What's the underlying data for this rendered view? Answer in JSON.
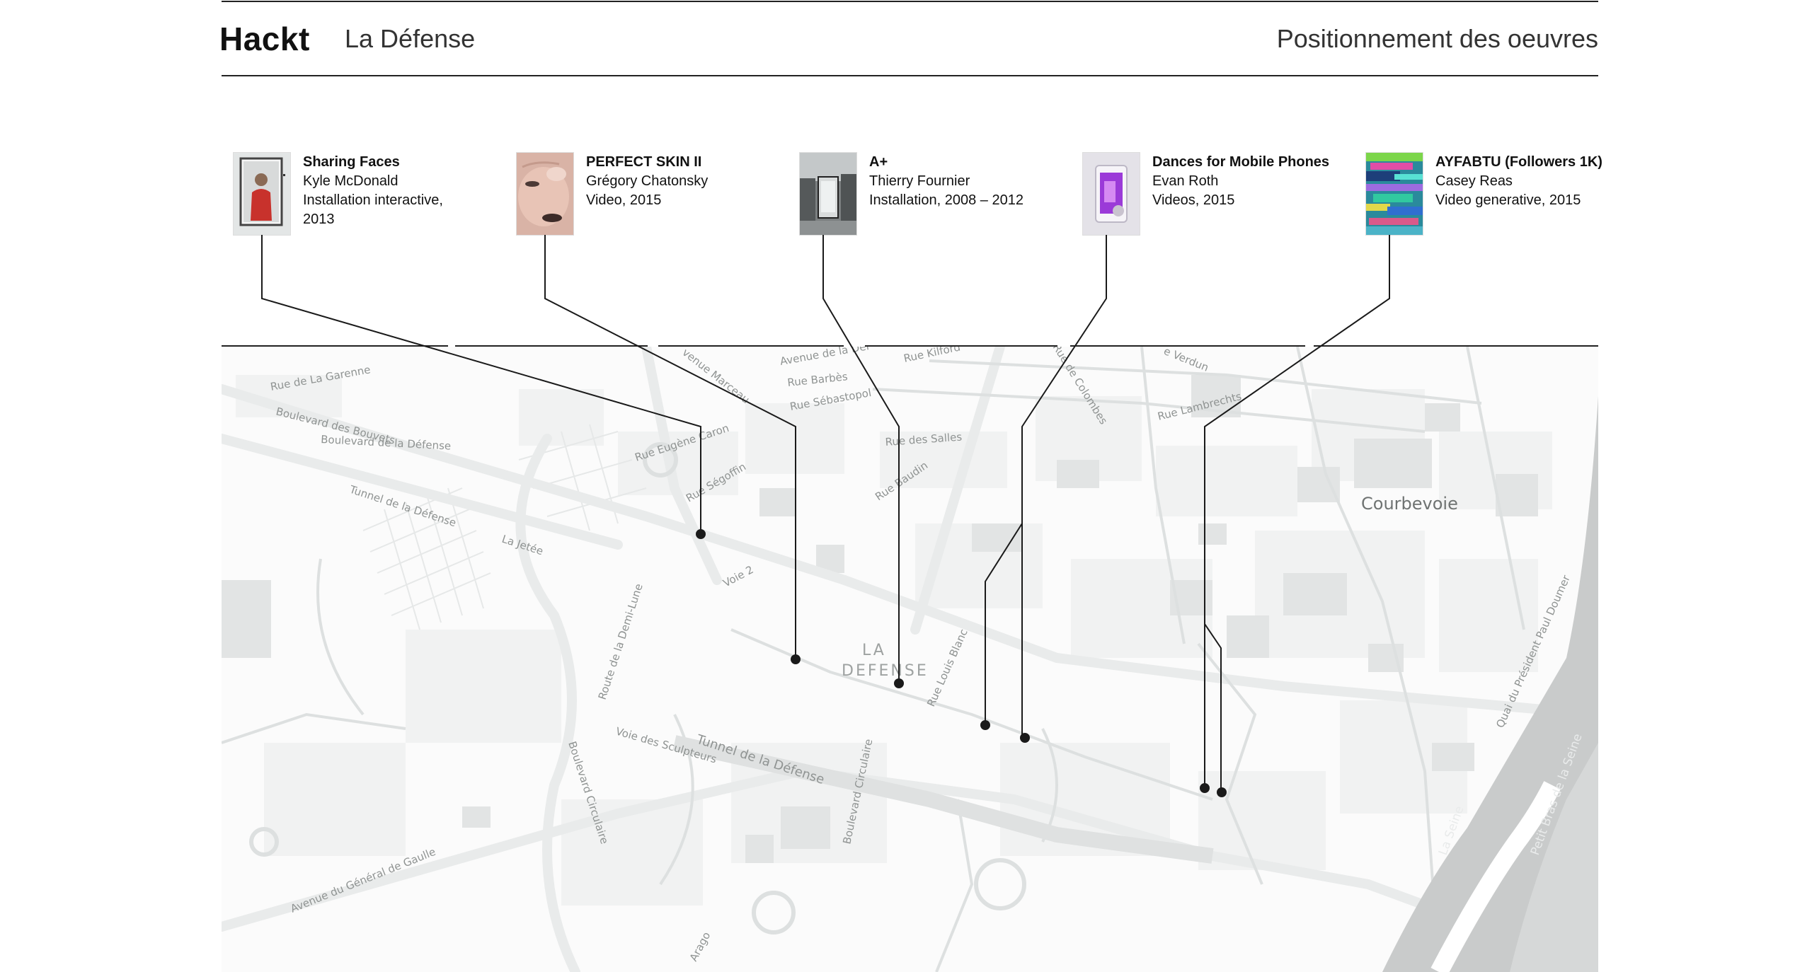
{
  "header": {
    "brand": "Hackt",
    "location": "La Défense",
    "section_title": "Positionnement des oeuvres"
  },
  "artworks": [
    {
      "title": "Sharing Faces",
      "artist": "Kyle McDonald",
      "medium": "Installation interactive,",
      "medium_2": "2013"
    },
    {
      "title": "PERFECT SKIN II",
      "artist": "Grégory Chatonsky",
      "medium": "Video, 2015"
    },
    {
      "title": "A+",
      "artist": "Thierry Fournier",
      "medium": "Installation, 2008 – 2012"
    },
    {
      "title": "Dances for Mobile Phones",
      "artist": "Evan Roth",
      "medium": "Videos, 2015"
    },
    {
      "title": "AYFABTU (Followers 1K)",
      "artist": "Casey Reas",
      "medium": "Video generative, 2015"
    }
  ],
  "map": {
    "city": "Courbevoie",
    "district": [
      "LA",
      "DEFENSE"
    ],
    "streets": {
      "rue_garenne": "Rue de La Garenne",
      "bd_bouvets": "Boulevard des Bouvets",
      "bd_defense": "Boulevard de la Défense",
      "tunnel_w": "Tunnel de la Défense",
      "jetee": "La Jetée",
      "voie2": "Voie 2",
      "demi_lune": "Route de la Demi-Lune",
      "bd_circ_w": "Boulevard Circulaire",
      "gaulle": "Avenue du Général de Gaulle",
      "marceau": "venue Marceau",
      "av_defense": "Avenue de la Déf",
      "kilford": "Rue Kilford",
      "barbes": "Rue Barbès",
      "sebastopol": "Rue Sébastopol",
      "colombes": "Rue de Colombes",
      "verdun": "e Verdun",
      "lambrechts": "Rue Lambrechts",
      "salles": "Rue des Salles",
      "eugene": "Rue Eugène Caron",
      "segoffin": "Rue Ségoffin",
      "baudin": "Rue Baudin",
      "louis_blanc": "Rue Louis Blanc",
      "doumer": "Quai du Président Paul Doumer",
      "sculpteurs": "Voie des Sculpteurs",
      "tunnel_e": "Tunnel de la Défense",
      "bd_circ_e": "Boulevard Circulaire",
      "seine": "La Seine",
      "petit_bras": "Petit Bras de la Seine",
      "arago": "Arago"
    }
  },
  "colors": {
    "ink": "#111111",
    "map_background": "#fbfbfb",
    "road": "#ebeded",
    "river": "#c9cbcb"
  }
}
